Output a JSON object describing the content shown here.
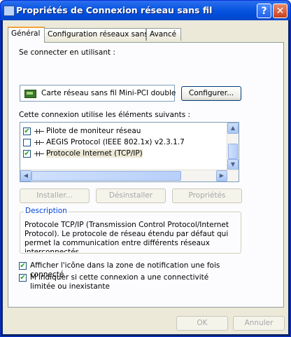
{
  "window": {
    "title": "Propriétés de Connexion réseau sans fil",
    "help_label": "?",
    "close_label": "✕"
  },
  "tabs": [
    {
      "label": "Général",
      "active": true
    },
    {
      "label": "Configuration réseaux sans fil",
      "active": false
    },
    {
      "label": "Avancé",
      "active": false
    }
  ],
  "connect_using": {
    "label": "Se connecter en utilisant :",
    "adapter_name": "Carte réseau sans fil Mini-PCI double",
    "adapter_icon": "network-card-icon",
    "configure_button": "Configurer..."
  },
  "components": {
    "label": "Cette connexion utilise les éléments suivants :",
    "items": [
      {
        "label": "Pilote de moniteur réseau",
        "checked": true,
        "icon": "protocol-icon"
      },
      {
        "label": "AEGIS Protocol (IEEE 802.1x) v2.3.1.7",
        "checked": false,
        "icon": "protocol-icon"
      },
      {
        "label": "Protocole Internet (TCP/IP)",
        "checked": true,
        "icon": "protocol-icon",
        "selected": true
      }
    ]
  },
  "buttons": {
    "install": "Installer...",
    "uninstall": "Désinstaller",
    "properties": "Propriétés"
  },
  "description": {
    "title": "Description",
    "text": "Protocole TCP/IP (Transmission Control Protocol/Internet Protocol). Le protocole de réseau étendu par défaut qui permet la communication entre différents réseaux interconnectés."
  },
  "options": {
    "show_icon": {
      "label": "Afficher l'icône dans la zone de notification une fois connecté",
      "checked": true
    },
    "notify_limited": {
      "label": "M'indiquer si cette connexion a une connectivité limitée ou inexistante",
      "checked": true
    }
  },
  "footer": {
    "ok": "OK",
    "cancel": "Annuler"
  },
  "colors": {
    "titlebar": "#0a56e0",
    "dialog_bg": "#ece9d8",
    "group_title": "#0046d5",
    "checkmark": "#21a121"
  }
}
